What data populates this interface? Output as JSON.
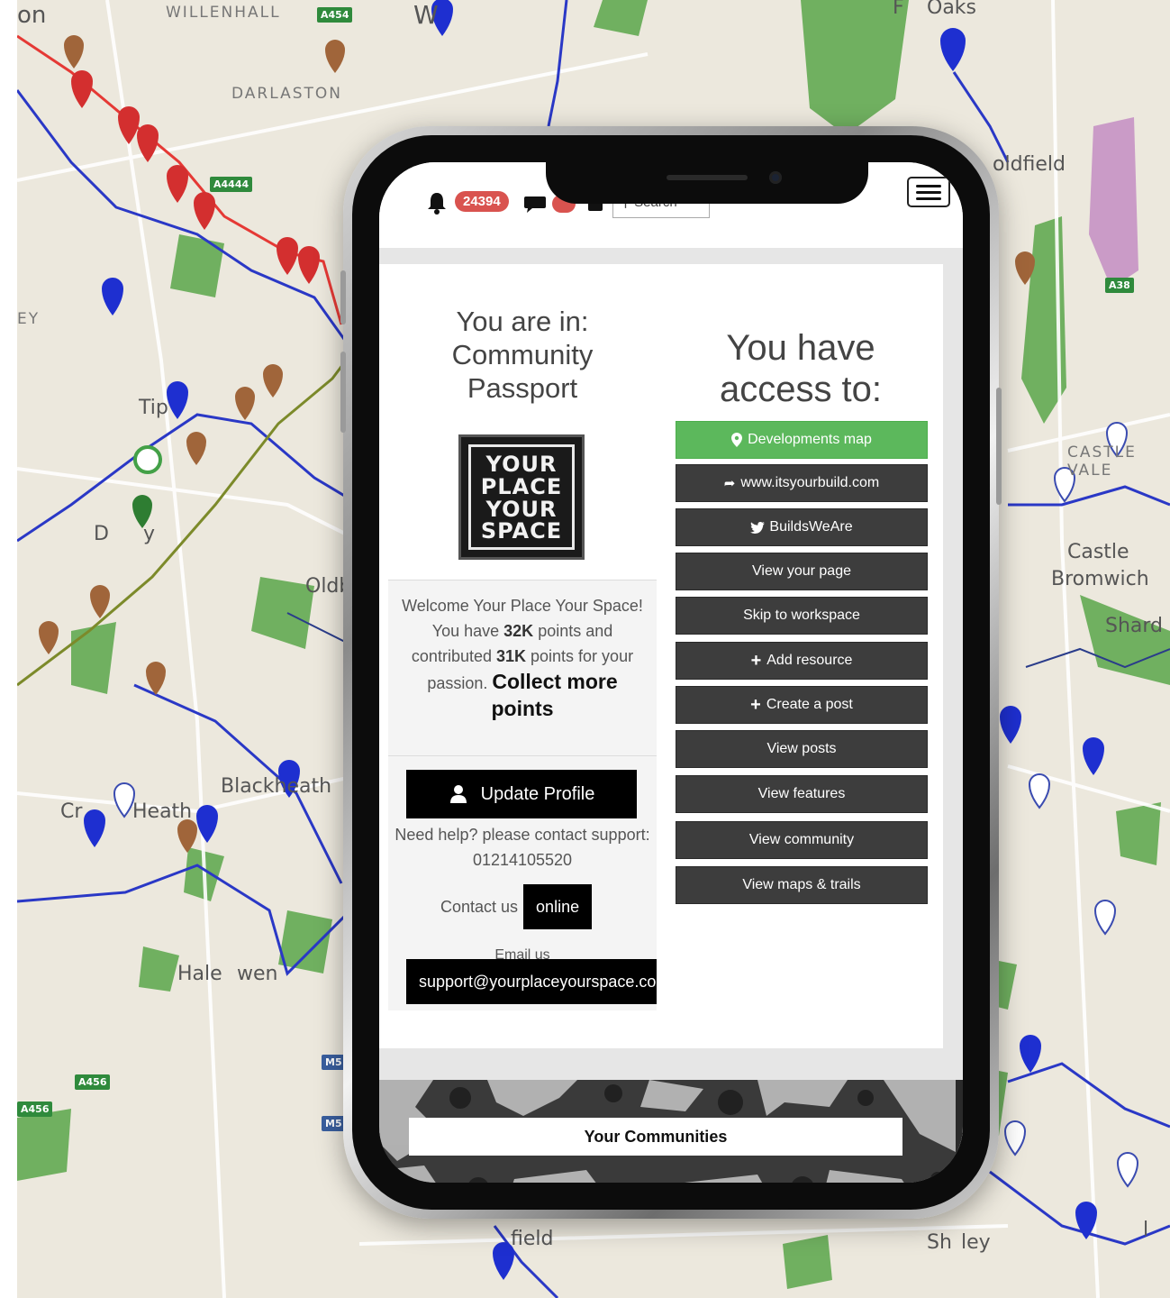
{
  "map": {
    "labels": [
      "on",
      "WILLENHALL",
      "DARLASTON",
      "Oaks",
      "oldfield",
      "CASTLE VALE",
      "Castle",
      "Bromwich",
      "Shard En",
      "Tip",
      "D",
      "y",
      "Oldb",
      "Cr",
      "Heath",
      "Blackheath",
      "Hale",
      "wen",
      "field",
      "Sh",
      "ley",
      "W",
      "l",
      "EY",
      "F"
    ],
    "roads": [
      "A454",
      "A4444",
      "A38",
      "A456",
      "A456",
      "M5",
      "M5"
    ]
  },
  "topbar": {
    "notification_count": "24394",
    "search_placeholder": "Search"
  },
  "left": {
    "location_lines": [
      "You are in:",
      "Community",
      "Passport"
    ],
    "logo_words": [
      "YOUR",
      "PLACE",
      "YOUR",
      "SPACE"
    ],
    "welcome_line1": "Welcome Your Place Your Space!",
    "points_prefix": "You have ",
    "points_value": "32K",
    "points_middle": " points and contributed ",
    "contributed_value": "31K",
    "points_suffix": " points for your passion. ",
    "collect_label": "Collect more points",
    "update_profile_label": "Update Profile",
    "help_text": "Need help? please contact support: 01214105520",
    "contact_label": "Contact us",
    "online_label": "online",
    "email_label": "Email us",
    "email_address": "support@yourplaceyourspace.com"
  },
  "right": {
    "access_title": "You have access to:",
    "buttons": [
      {
        "label": "Developments map",
        "icon": "map-marker-icon"
      },
      {
        "label": "www.itsyourbuild.com",
        "icon": "share-icon"
      },
      {
        "label": "BuildsWeAre",
        "icon": "twitter-icon"
      },
      {
        "label": "View your page",
        "icon": ""
      },
      {
        "label": "Skip to workspace",
        "icon": ""
      },
      {
        "label": "Add resource",
        "icon": "plus-icon"
      },
      {
        "label": "Create a post",
        "icon": "plus-icon"
      },
      {
        "label": "View posts",
        "icon": ""
      },
      {
        "label": "View features",
        "icon": ""
      },
      {
        "label": "View community",
        "icon": ""
      },
      {
        "label": "View maps & trails",
        "icon": ""
      }
    ]
  },
  "communities": {
    "title": "Your Communities"
  },
  "colors": {
    "accent_green": "#5cb85c",
    "button_dark": "#3d3d3d",
    "badge_red": "#d9534f"
  }
}
